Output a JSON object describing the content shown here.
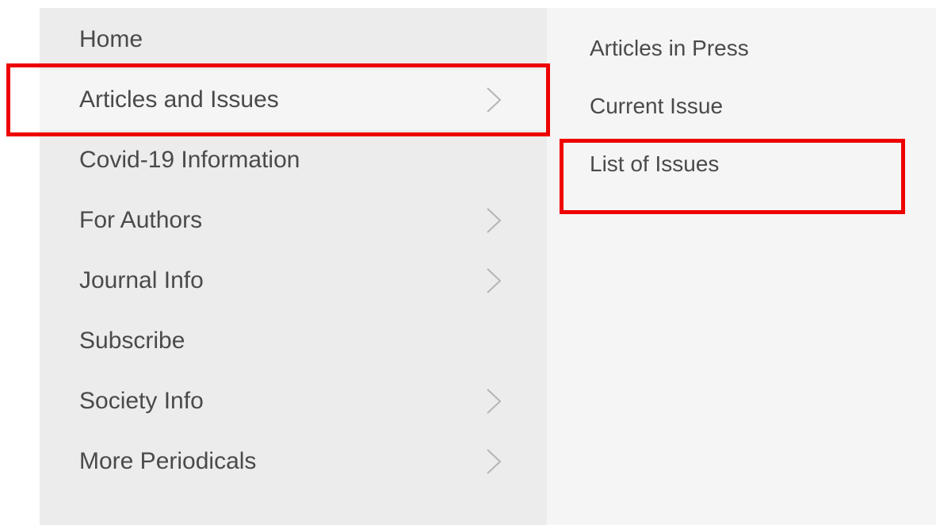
{
  "menu": {
    "items": [
      {
        "label": "Home",
        "has_submenu": false
      },
      {
        "label": "Articles and Issues",
        "has_submenu": true,
        "active": true
      },
      {
        "label": "Covid-19 Information",
        "has_submenu": false
      },
      {
        "label": "For Authors",
        "has_submenu": true
      },
      {
        "label": "Journal Info",
        "has_submenu": true
      },
      {
        "label": "Subscribe",
        "has_submenu": false
      },
      {
        "label": "Society Info",
        "has_submenu": true
      },
      {
        "label": "More Periodicals",
        "has_submenu": true
      }
    ],
    "chevron_icon": "chevron-right-icon"
  },
  "submenu": {
    "items": [
      {
        "label": "Articles in Press"
      },
      {
        "label": "Current Issue"
      },
      {
        "label": "List of Issues"
      }
    ]
  },
  "colors": {
    "main_panel_bg": "#ececec",
    "sub_panel_bg": "#f5f5f5",
    "text": "#4a4a4a",
    "chevron": "#b5b5b5",
    "highlight_box": "#ee0000"
  }
}
